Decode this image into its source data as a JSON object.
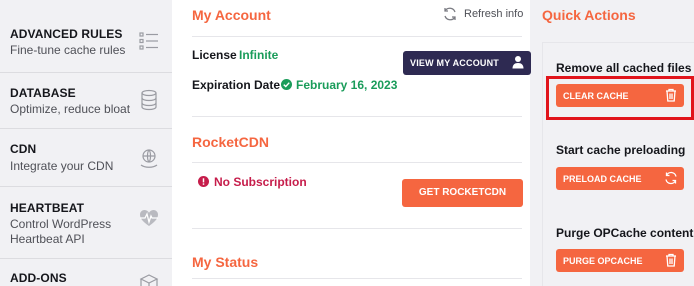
{
  "sidebar": {
    "items": [
      {
        "title": "ADVANCED RULES",
        "desc": "Fine-tune cache rules",
        "icon": "list-icon"
      },
      {
        "title": "DATABASE",
        "desc": "Optimize, reduce bloat",
        "icon": "database-icon"
      },
      {
        "title": "CDN",
        "desc": "Integrate your CDN",
        "icon": "cdn-globe-icon"
      },
      {
        "title": "HEARTBEAT",
        "desc_line1": "Control WordPress",
        "desc_line2": "Heartbeat API",
        "icon": "heartbeat-icon"
      },
      {
        "title": "ADD-ONS",
        "icon": "addons-cube-icon"
      }
    ]
  },
  "account": {
    "title": "My Account",
    "refresh_label": "Refresh info",
    "license_label": "License",
    "license_value": "Infinite",
    "expiration_label": "Expiration Date",
    "expiration_value": "February 16, 2023",
    "view_account_label": "VIEW MY ACCOUNT"
  },
  "rocketcdn": {
    "title": "RocketCDN",
    "status": "No Subscription",
    "button_label": "GET ROCKETCDN"
  },
  "status": {
    "title": "My Status"
  },
  "quick_actions": {
    "title": "Quick Actions",
    "remove_label": "Remove all cached files",
    "clear_cache_label": "CLEAR CACHE",
    "preload_label": "Start cache preloading",
    "preload_button_label": "PRELOAD CACHE",
    "opcache_label": "Purge OPCache content",
    "opcache_button_label": "PURGE OPCACHE"
  },
  "colors": {
    "accent": "#f56640",
    "dark_button": "#2e2a52",
    "success": "#1a9c5a",
    "error": "#c61d4b",
    "highlight": "#e1141b"
  }
}
